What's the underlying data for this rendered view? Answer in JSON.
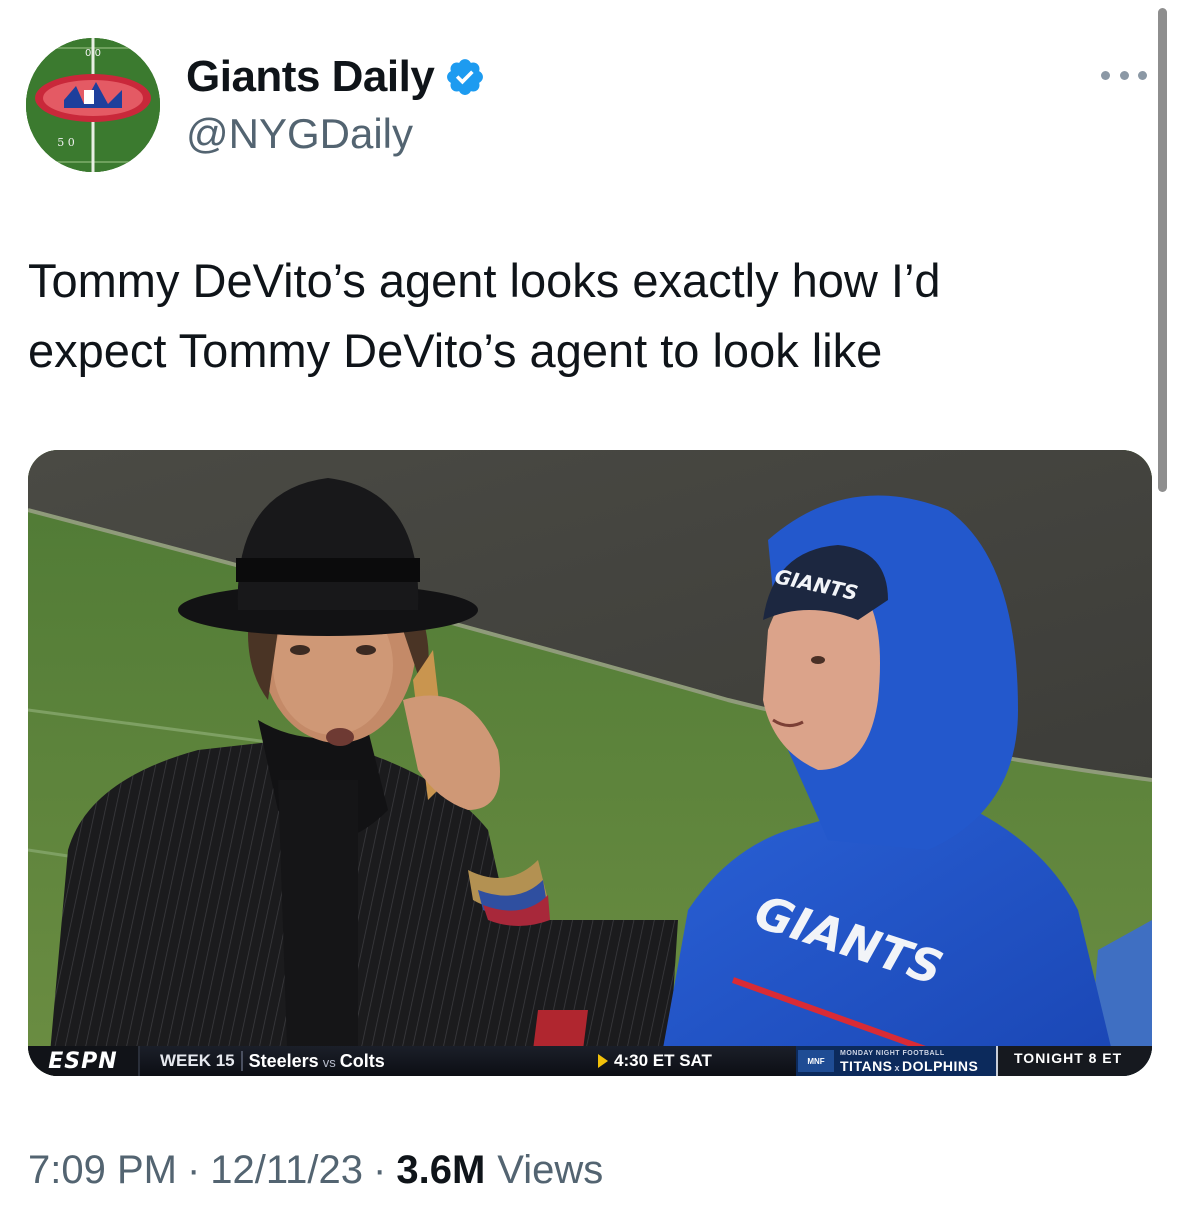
{
  "tweet": {
    "display_name": "Giants Daily",
    "handle": "@NYGDaily",
    "verified_icon": "verified-badge-icon",
    "more_icon": "more-options-icon",
    "text_line_1": "Tommy DeVito’s agent looks exactly how I’d",
    "text_line_2": "expect Tommy DeVito’s agent to look like",
    "time": "7:09 PM",
    "separator": "·",
    "date": "12/11/23",
    "views_count": "3.6M",
    "views_label": "Views"
  },
  "avatar": {
    "yard_top": "0 0",
    "yard_bottom": "5 0"
  },
  "media": {
    "beanie_text": "GIANTS",
    "hoodie_text": "GIANTS",
    "ticker": {
      "network": "ESPN",
      "week": "WEEK 15",
      "team_a": "Steelers",
      "vs": "vs",
      "team_b": "Colts",
      "time": "4:30 ET SAT",
      "mnf_logo": "MNF",
      "mnf_label": "MONDAY NIGHT FOOTBALL",
      "mnf_team_a": "TITANS",
      "mnf_x": "x",
      "mnf_team_b": "DOLPHINS",
      "tonight": "TONIGHT 8 ET"
    }
  },
  "colors": {
    "accent_blue": "#1d9bf0",
    "text_primary": "#0f1419",
    "text_secondary": "#536471",
    "giants_blue": "#1f4fc9"
  }
}
